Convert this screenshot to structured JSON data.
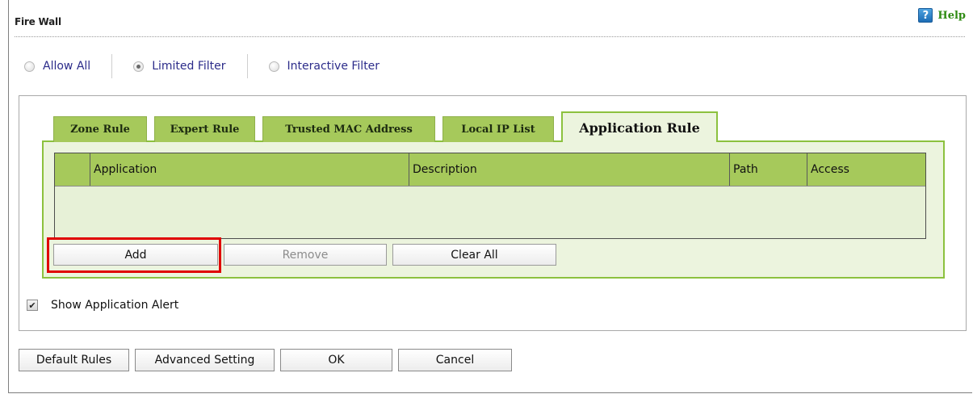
{
  "header": {
    "title": "Fire Wall",
    "help_label": "Help",
    "help_icon": "question-mark-icon",
    "help_icon_glyph": "?"
  },
  "filter_mode": {
    "options": [
      {
        "label": "Allow All",
        "selected": false
      },
      {
        "label": "Limited Filter",
        "selected": true
      },
      {
        "label": "Interactive Filter",
        "selected": false
      }
    ]
  },
  "tabs": [
    {
      "label": "Zone Rule",
      "active": false
    },
    {
      "label": "Expert Rule",
      "active": false
    },
    {
      "label": "Trusted MAC Address",
      "active": false
    },
    {
      "label": "Local IP List",
      "active": false
    },
    {
      "label": "Application Rule",
      "active": true
    }
  ],
  "table": {
    "columns": [
      "",
      "Application",
      "Description",
      "Path",
      "Access"
    ],
    "rows": []
  },
  "table_buttons": {
    "add": "Add",
    "remove": "Remove",
    "clear_all": "Clear All"
  },
  "options": {
    "show_app_alert_label": "Show Application Alert",
    "show_app_alert_checked": true,
    "checkmark_glyph": "✔"
  },
  "footer": {
    "default_rules": "Default Rules",
    "advanced_setting": "Advanced Setting",
    "ok": "OK",
    "cancel": "Cancel"
  },
  "colors": {
    "tab_green": "#a6c95b",
    "panel_bg": "#ecf4de",
    "active_border": "#8cc13e",
    "highlight_red": "#e00000",
    "help_green": "#2e8b12",
    "radio_label": "#2c2c8a"
  }
}
